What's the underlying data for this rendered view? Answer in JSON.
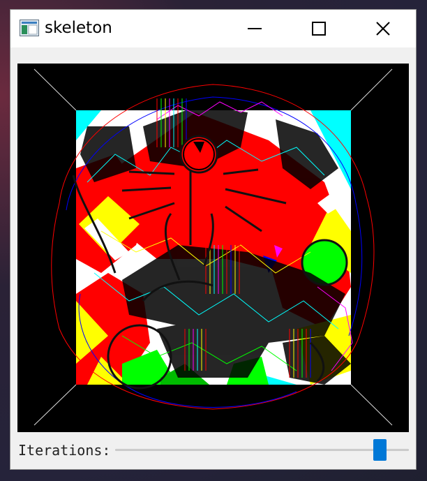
{
  "window": {
    "title": "skeleton",
    "icon": "app-window-icon"
  },
  "titlebar_buttons": [
    "minimize-icon",
    "maximize-icon",
    "close-icon"
  ],
  "canvas": {
    "description_colors": {
      "background": "#000000",
      "red": "#ff0000",
      "yellow": "#ffff00",
      "cyan": "#00ffff",
      "green": "#00ff00",
      "white": "#ffffff",
      "magenta": "#ff00ff",
      "blue": "#0000ff"
    }
  },
  "controls": {
    "iterations_label": "Iterations:",
    "slider_value_fraction": 0.92
  },
  "colors": {
    "accent": "#0078d7",
    "window_bg": "#f0f0f0"
  }
}
